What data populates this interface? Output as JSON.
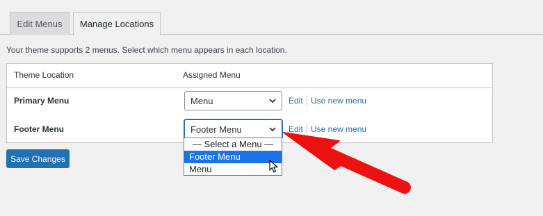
{
  "tabs": [
    {
      "label": "Edit Menus",
      "active": false
    },
    {
      "label": "Manage Locations",
      "active": true
    }
  ],
  "intro_text": "Your theme supports 2 menus. Select which menu appears in each location.",
  "table": {
    "headers": [
      "Theme Location",
      "Assigned Menu"
    ],
    "rows": [
      {
        "location": "Primary Menu",
        "selected": "Menu",
        "edit_label": "Edit",
        "new_label": "Use new menu"
      },
      {
        "location": "Footer Menu",
        "selected": "Footer Menu",
        "edit_label": "Edit",
        "new_label": "Use new menu"
      }
    ]
  },
  "dropdown_options": [
    "— Select a Menu —",
    "Footer Menu",
    "Menu"
  ],
  "dropdown_highlighted": "Footer Menu",
  "save_label": "Save Changes",
  "icons": {
    "select_arrow": "chevron-down-icon",
    "pointer": "mouse-cursor-icon",
    "annotation": "red-arrow-annotation"
  },
  "colors": {
    "accent": "#2271b1",
    "highlight": "#1a73e8",
    "annotation": "#ee1111",
    "background": "#f0f0f1"
  }
}
